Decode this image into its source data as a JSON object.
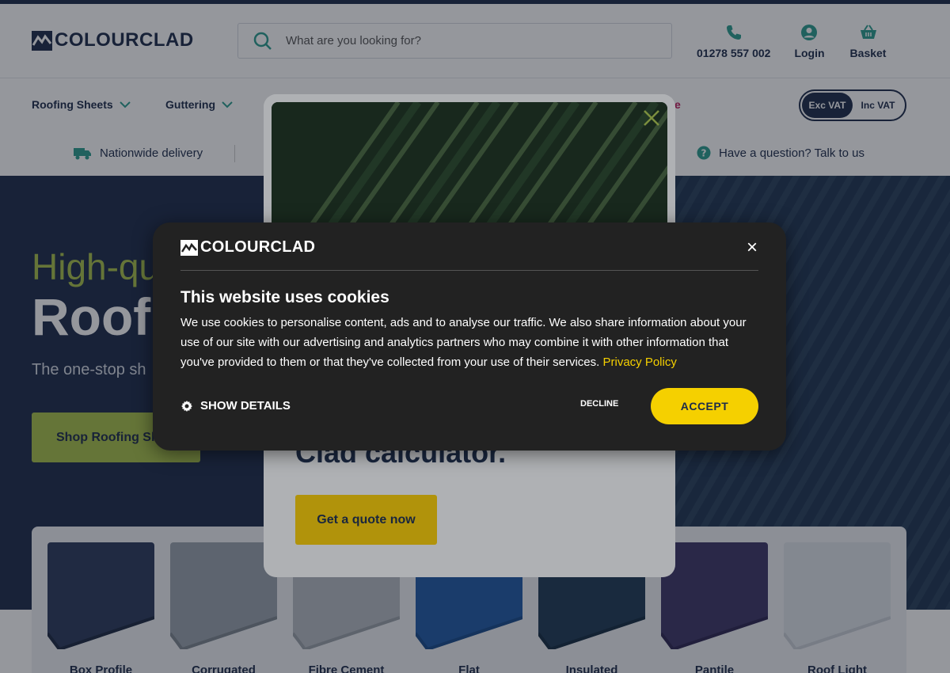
{
  "header": {
    "logo_text_a": "COLOUR",
    "logo_text_b": "CLAD",
    "search_placeholder": "What are you looking for?",
    "phone_label": "01278 557 002",
    "login_label": "Login",
    "basket_label": "Basket"
  },
  "nav": {
    "items": [
      {
        "label": "Roofing Sheets"
      },
      {
        "label": "Guttering"
      }
    ],
    "partial_label": "e",
    "vat_toggle": {
      "exc": "Exc VAT",
      "inc": "Inc VAT"
    }
  },
  "usp": {
    "delivery": "Nationwide delivery",
    "question": "Have a question? Talk to us"
  },
  "hero": {
    "line1": "High-qu",
    "line2": "Roofi",
    "subtitle": "The one-stop sh",
    "button": "Shop Roofing She"
  },
  "categories": [
    {
      "label": "Box Profile",
      "color": "#2b3a5c"
    },
    {
      "label": "Corrugated",
      "color": "#9aa3ad"
    },
    {
      "label": "Fibre Cement",
      "color": "#b7bcc4"
    },
    {
      "label": "Flat",
      "color": "#1f5aa6"
    },
    {
      "label": "Insulated",
      "color": "#1e3a55"
    },
    {
      "label": "Pantile",
      "color": "#3d3567"
    },
    {
      "label": "Roof Light",
      "color": "#dfe3ea"
    }
  ],
  "popup": {
    "heading": "Clad calculator.",
    "button": "Get a quote now"
  },
  "cookie": {
    "logo_text": "COLOURCLAD",
    "title": "This website uses cookies",
    "body": "We use cookies to personalise content, ads and to analyse our traffic. We also share information about your use of our site with our advertising and analytics partners who may combine it with other information that you've provided to them or that they've collected from your use of their services. ",
    "privacy_link": "Privacy Policy",
    "show_details": "SHOW DETAILS",
    "decline": "DECLINE",
    "accept": "ACCEPT",
    "close": "×"
  },
  "colors": {
    "navy": "#1c2b4a",
    "green": "#a8c14a",
    "yellow": "#f5d000",
    "teal": "#2a9d8f"
  }
}
